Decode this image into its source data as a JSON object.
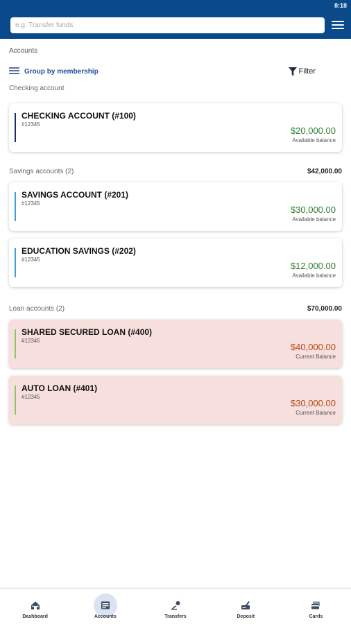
{
  "status": {
    "time": "8:18"
  },
  "search": {
    "placeholder": "e.g. Transfer funds"
  },
  "page": {
    "title": "Accounts"
  },
  "toolbar": {
    "group_label": "Group by membership",
    "filter_label": "Filter"
  },
  "sections": {
    "checking": {
      "title": "Checking account",
      "total": ""
    },
    "savings": {
      "title": "Savings accounts (2)",
      "total": "$42,000.00"
    },
    "loans": {
      "title": "Loan accounts (2)",
      "total": "$70,000.00"
    }
  },
  "accounts": [
    {
      "name": "CHECKING ACCOUNT (#100)",
      "number": "#12345",
      "balance": "$20,000.00",
      "balance_label": "Available balance"
    },
    {
      "name": "SAVINGS ACCOUNT (#201)",
      "number": "#12345",
      "balance": "$30,000.00",
      "balance_label": "Available balance"
    },
    {
      "name": "EDUCATION SAVINGS (#202)",
      "number": "#12345",
      "balance": "$12,000.00",
      "balance_label": "Available balance"
    },
    {
      "name": "SHARED SECURED LOAN (#400)",
      "number": "#12345",
      "balance": "$40,000.00",
      "balance_label": "Current Balance"
    },
    {
      "name": "AUTO LOAN (#401)",
      "number": "#12345",
      "balance": "$30,000.00",
      "balance_label": "Current Balance"
    }
  ],
  "colors": {
    "header": "#0b4a8a",
    "checking_accent": "#1f2a6b",
    "savings_accent": "#3aa0d8",
    "loan_accent": "#8cc66a",
    "positive_balance": "#2e7d32",
    "loan_balance": "#b34a14",
    "loan_card_bg": "#f7dfdd"
  },
  "nav": {
    "active": "accounts",
    "items": [
      {
        "id": "dashboard",
        "label": "Dashboard",
        "icon": "house-icon"
      },
      {
        "id": "accounts",
        "label": "Accounts",
        "icon": "bank-icon"
      },
      {
        "id": "transfers",
        "label": "Transfers",
        "icon": "transfer-icon"
      },
      {
        "id": "deposit",
        "label": "Deposit",
        "icon": "check-deposit-icon"
      },
      {
        "id": "cards",
        "label": "Cards",
        "icon": "cards-icon"
      }
    ]
  }
}
